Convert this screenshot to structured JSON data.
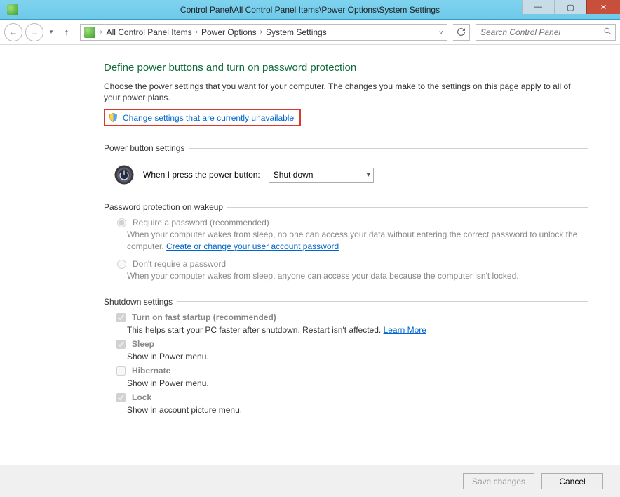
{
  "window": {
    "title": "Control Panel\\All Control Panel Items\\Power Options\\System Settings"
  },
  "breadcrumbs": {
    "lead": "«",
    "items": [
      "All Control Panel Items",
      "Power Options",
      "System Settings"
    ]
  },
  "search": {
    "placeholder": "Search Control Panel"
  },
  "heading": "Define power buttons and turn on password protection",
  "intro": "Choose the power settings that you want for your computer. The changes you make to the settings on this page apply to all of your power plans.",
  "shield_link": "Change settings that are currently unavailable",
  "sections": {
    "power_button": {
      "legend": "Power button settings",
      "label": "When I press the power button:",
      "value": "Shut down"
    },
    "password": {
      "legend": "Password protection on wakeup",
      "opt1": {
        "label": "Require a password (recommended)",
        "desc_a": "When your computer wakes from sleep, no one can access your data without entering the correct password to unlock the computer. ",
        "link": "Create or change your user account password"
      },
      "opt2": {
        "label": "Don't require a password",
        "desc": "When your computer wakes from sleep, anyone can access your data because the computer isn't locked."
      }
    },
    "shutdown": {
      "legend": "Shutdown settings",
      "items": [
        {
          "label": "Turn on fast startup (recommended)",
          "desc": "This helps start your PC faster after shutdown. Restart isn't affected. ",
          "link": "Learn More",
          "checked": true
        },
        {
          "label": "Sleep",
          "desc": "Show in Power menu.",
          "link": "",
          "checked": true
        },
        {
          "label": "Hibernate",
          "desc": "Show in Power menu.",
          "link": "",
          "checked": false
        },
        {
          "label": "Lock",
          "desc": "Show in account picture menu.",
          "link": "",
          "checked": true
        }
      ]
    }
  },
  "footer": {
    "save": "Save changes",
    "cancel": "Cancel"
  }
}
